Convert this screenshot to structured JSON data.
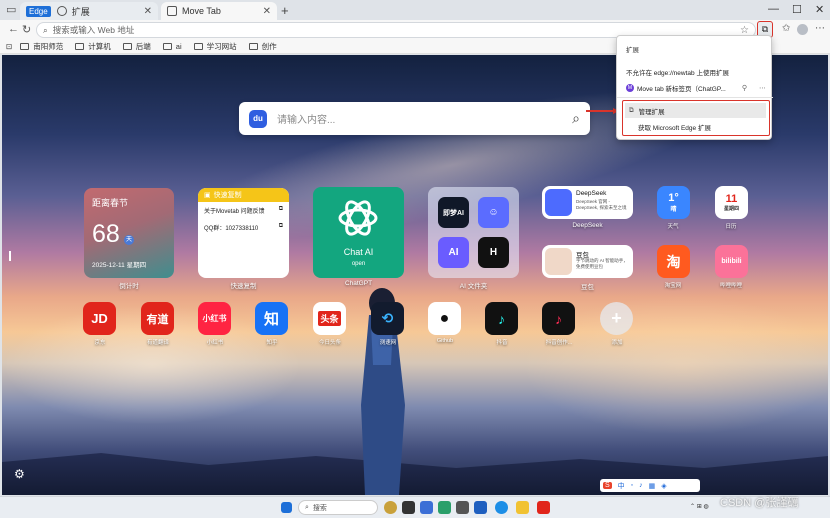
{
  "browser": {
    "tabs": [
      {
        "label": "扩展",
        "badge": "Edge",
        "active": false
      },
      {
        "label": "Move Tab",
        "active": true
      }
    ],
    "address": {
      "placeholder": "搜索或输入 Web 地址"
    },
    "bookmarks": [
      "南阳师范",
      "计算机",
      "后端",
      "ai",
      "学习网站",
      "创作"
    ]
  },
  "search": {
    "placeholder": "请输入内容..."
  },
  "widgets": {
    "countdown": {
      "title": "距离春节",
      "days": "68",
      "unit": "天",
      "date": "2025-12-11 星期四",
      "label": "倒计时"
    },
    "copy": {
      "header": "快速复制",
      "rows": [
        "关于Movetab 问题反馈",
        "QQ群：1027338110"
      ],
      "label": "快速复制"
    },
    "chatgpt": {
      "name": "Chat AI",
      "open": "open",
      "label": "ChatGPT"
    },
    "ai_group": {
      "label": "AI 文件夹",
      "icons": [
        "即梦AI",
        "",
        "AI",
        "H"
      ]
    },
    "deepseek": {
      "title": "DeepSeek",
      "desc": "DeepSeek 官网 - DeepSeek, 探索未至之境",
      "label": "DeepSeek"
    },
    "doubao": {
      "title": "豆包",
      "desc": "字节跳动的 AI 智能助手，免费使用豆包",
      "label": "豆包"
    },
    "weather": {
      "temp": "1°",
      "cond": "晴",
      "label": "天气"
    },
    "calendar": {
      "day": "11",
      "weekday": "星期四",
      "label": "日历"
    }
  },
  "apps_row1": [
    {
      "label": "淘宝网",
      "text": "淘",
      "color": "#ff5a1f"
    },
    {
      "label": "哔哩哔哩",
      "text": "bilibili",
      "color": "#fb7299"
    }
  ],
  "apps_row2": [
    {
      "label": "京东",
      "text": "JD",
      "color": "#e1251b"
    },
    {
      "label": "有道翻译",
      "text": "有道",
      "color": "#e1251b"
    },
    {
      "label": "小红书",
      "text": "小红书",
      "color": "#ff2442"
    },
    {
      "label": "知乎",
      "text": "知",
      "color": "#1772f6"
    },
    {
      "label": "今日头条",
      "text": "头条",
      "color": "#ffffff"
    },
    {
      "label": "测速网",
      "text": "",
      "color": "#121b2e"
    },
    {
      "label": "Github",
      "text": "",
      "color": "#ffffff"
    },
    {
      "label": "抖音",
      "text": "",
      "color": "#111111"
    },
    {
      "label": "抖音创作...",
      "text": "",
      "color": "#111111"
    },
    {
      "label": "添加",
      "text": "+",
      "color": "#cfd3db"
    }
  ],
  "ext_menu": {
    "title": "扩展",
    "not_allowed": "不允许在 edge://newtab 上使用扩展",
    "item": "Move tab 新标签页（ChatGP...",
    "manage": "管理扩展",
    "get": "获取 Microsoft Edge 扩展"
  },
  "taskbar": {
    "search": "搜索"
  },
  "watermark": "CSDN @张謹礪",
  "colors": {
    "accent": "#1d6fd8",
    "highlight_red": "#d9342b",
    "chatgpt": "#13a67f"
  }
}
